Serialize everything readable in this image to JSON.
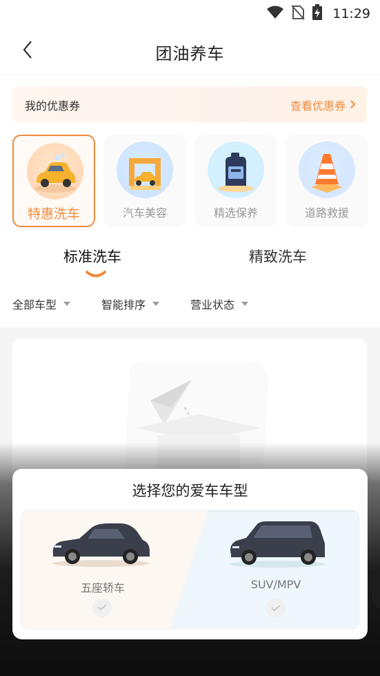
{
  "status_bar": {
    "time": "11:29",
    "icons": [
      "wifi-icon",
      "no-sim-icon",
      "battery-charging-icon"
    ]
  },
  "header": {
    "title": "团油养车",
    "back_icon": "chevron-left-icon"
  },
  "coupon": {
    "title": "我的优惠券",
    "link_label": "查看优惠券",
    "link_icon": "chevron-right-icon",
    "accent": "#f08a3c"
  },
  "services": [
    {
      "label": "特惠洗车",
      "icon": "car-wash-icon",
      "active": true
    },
    {
      "label": "汽车美容",
      "icon": "car-beauty-icon",
      "active": false
    },
    {
      "label": "精选保养",
      "icon": "oil-bottle-icon",
      "active": false
    },
    {
      "label": "道路救援",
      "icon": "traffic-cone-icon",
      "active": false
    }
  ],
  "tabs": [
    {
      "label": "标准洗车",
      "active": true
    },
    {
      "label": "精致洗车",
      "active": false
    }
  ],
  "filters": [
    {
      "label": "全部车型"
    },
    {
      "label": "智能排序"
    },
    {
      "label": "营业状态"
    }
  ],
  "sheet": {
    "title": "选择您的爱车车型",
    "options": [
      {
        "label": "五座轿车",
        "icon": "sedan-icon"
      },
      {
        "label": "SUV/MPV",
        "icon": "suv-icon"
      }
    ]
  }
}
